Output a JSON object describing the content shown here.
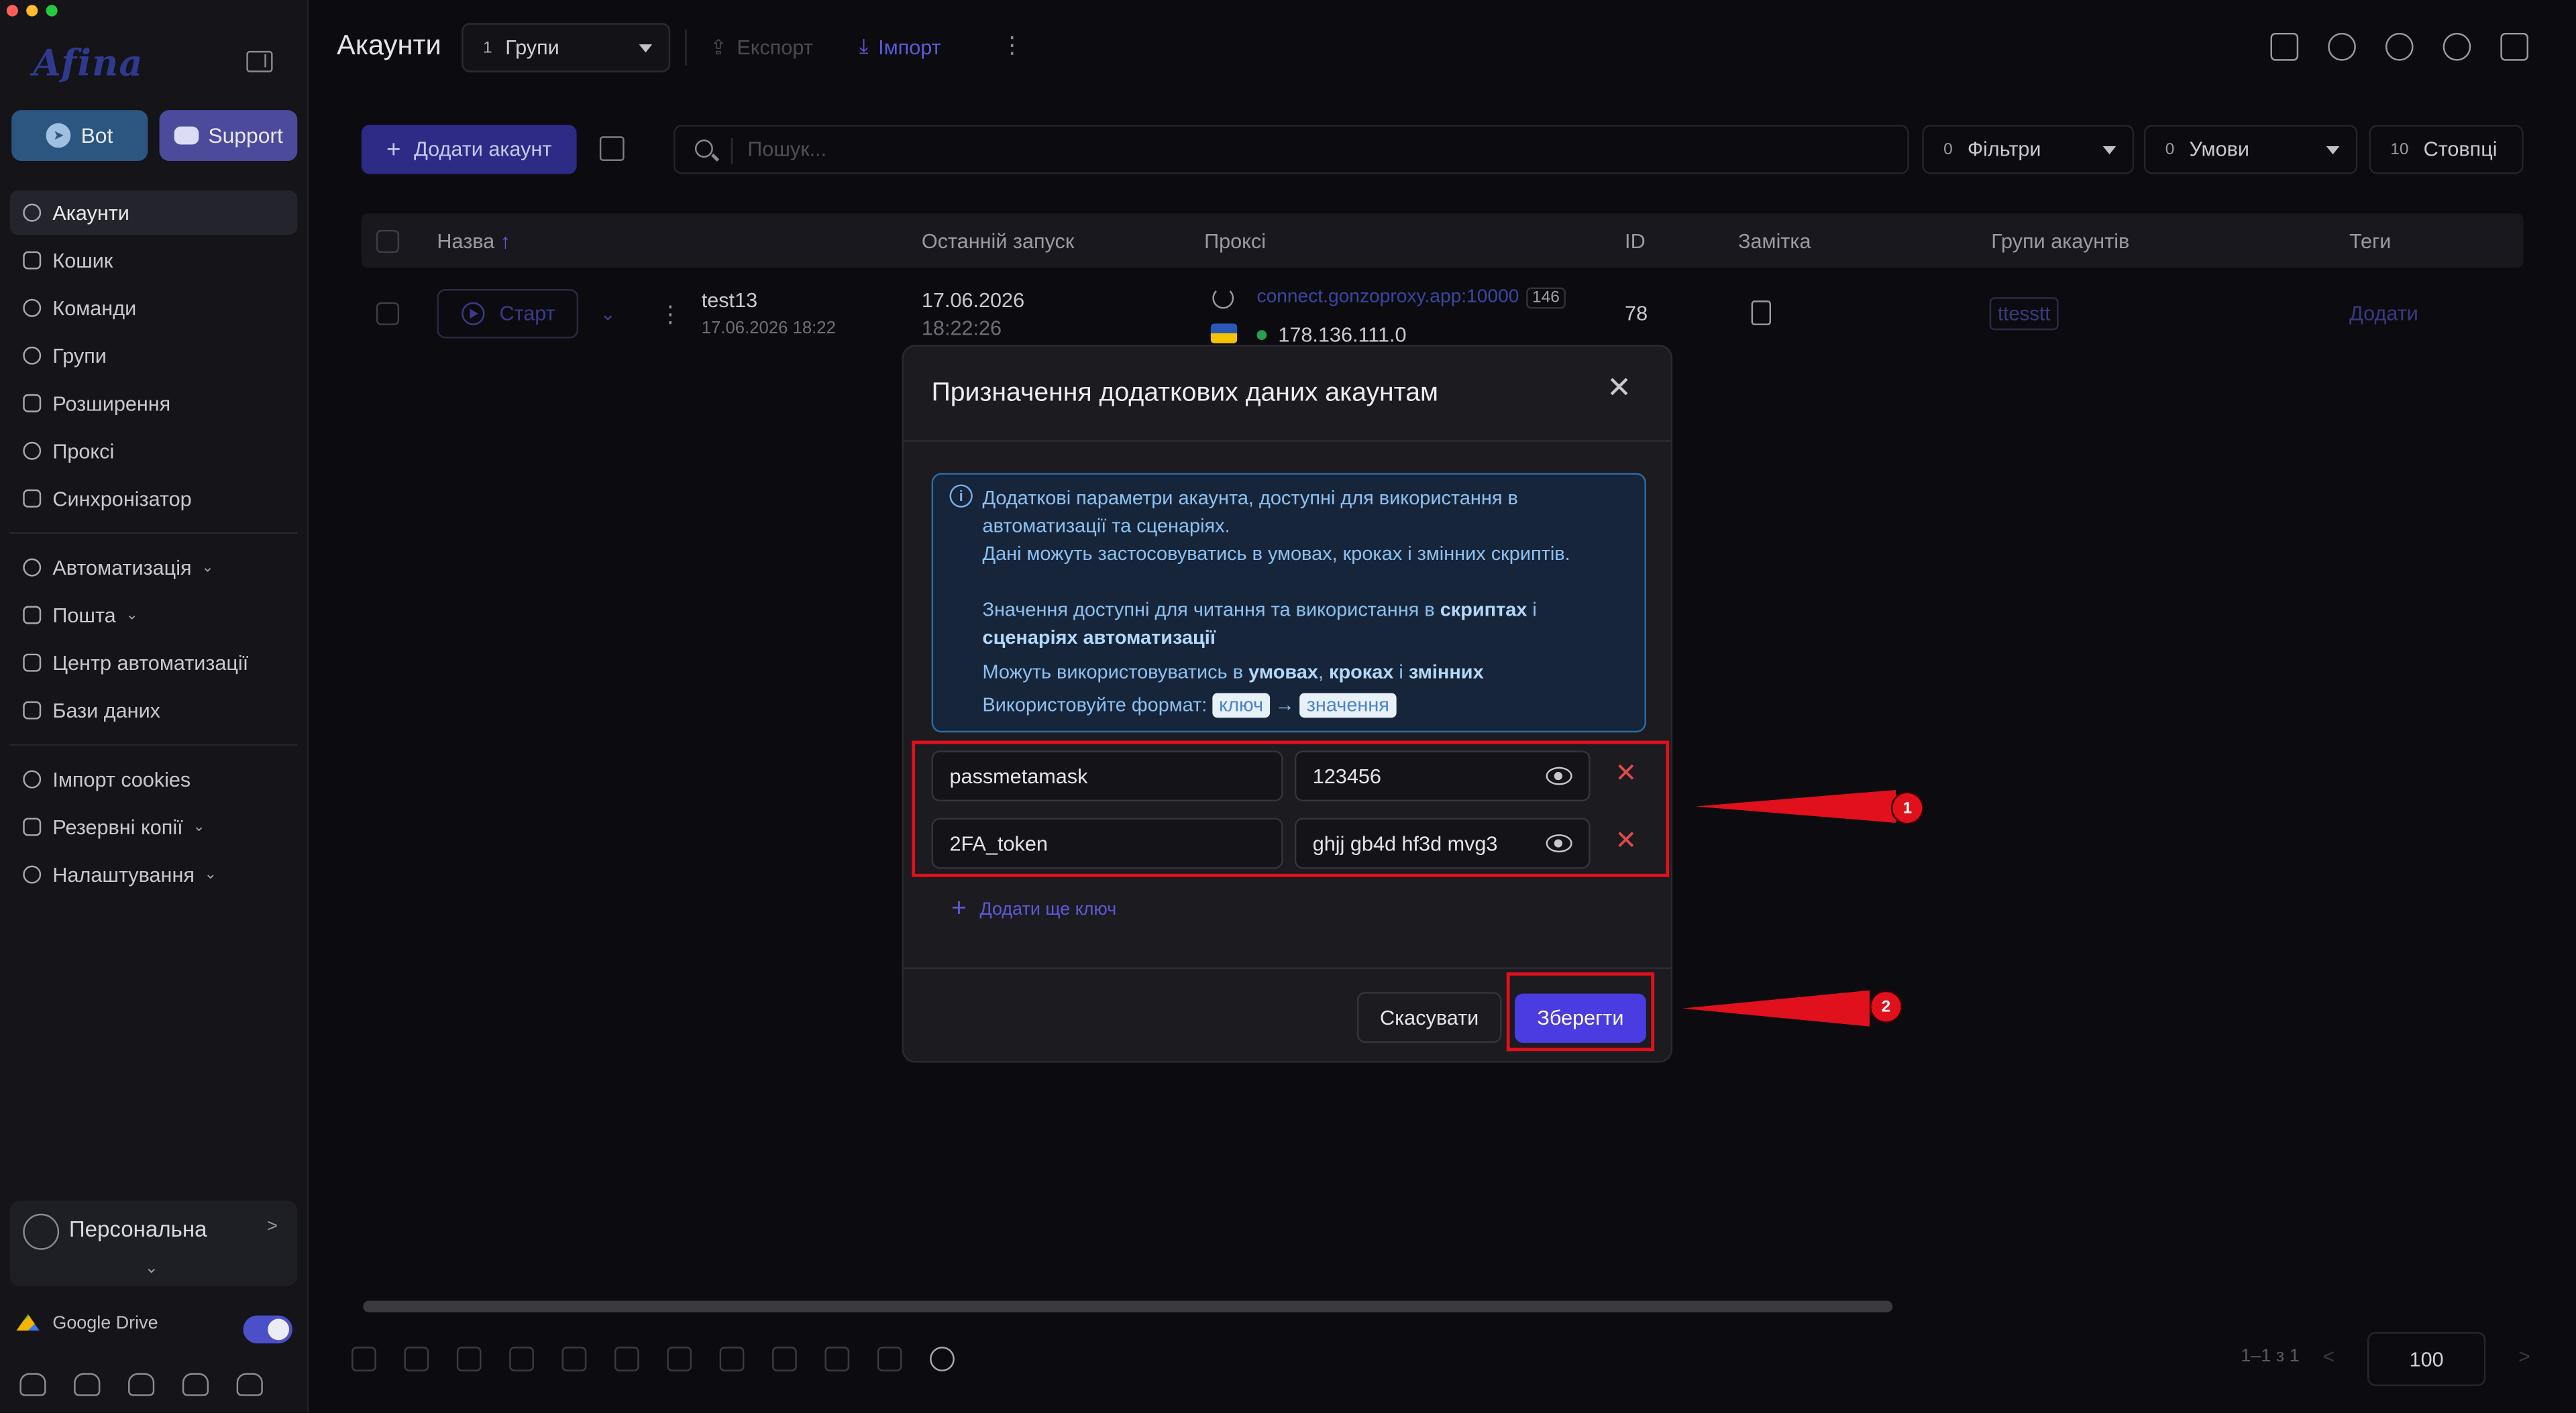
{
  "app": {
    "logo": "Afina"
  },
  "sidebar": {
    "bot_label": "Bot",
    "support_label": "Support",
    "items": [
      {
        "label": "Акаунти"
      },
      {
        "label": "Кошик"
      },
      {
        "label": "Команди"
      },
      {
        "label": "Групи"
      },
      {
        "label": "Розширення"
      },
      {
        "label": "Проксі"
      },
      {
        "label": "Синхронізатор"
      },
      {
        "label": "Автоматизація"
      },
      {
        "label": "Пошта"
      },
      {
        "label": "Центр автоматизації"
      },
      {
        "label": "Бази даних"
      },
      {
        "label": "Імпорт cookies"
      },
      {
        "label": "Резервні копії"
      },
      {
        "label": "Налаштування"
      }
    ],
    "profile_label": "Персональна",
    "gdrive_label": "Google Drive",
    "gdrive_enabled": true
  },
  "header": {
    "title": "Акаунти",
    "group_count": "1",
    "group_label": "Групи",
    "export_label": "Експорт",
    "import_label": "Імпорт"
  },
  "toolbar": {
    "add_account_label": "Додати акаунт",
    "search_placeholder": "Пошук...",
    "filters_count": "0",
    "filters_label": "Фільтри",
    "conditions_count": "0",
    "conditions_label": "Умови",
    "columns_count": "10",
    "columns_label": "Стовпці"
  },
  "table": {
    "columns": [
      "Назва",
      "Останній запуск",
      "Проксі",
      "ID",
      "Замітка",
      "Групи акаунтів",
      "Теги"
    ],
    "row": {
      "start_label": "Старт",
      "name": "test13",
      "created": "17.06.2026 18:22",
      "last_run_date": "17.06.2026",
      "last_run_time": "18:22:26",
      "proxy_host": "connect.gonzoproxy.app:10000",
      "proxy_badge": "146",
      "proxy_ip": "178.136.111.0",
      "id": "78",
      "group_tag": "ttesstt",
      "tags_link": "Додати"
    }
  },
  "pagination": {
    "range": "1–1 з 1",
    "per_page": "100"
  },
  "modal": {
    "title": "Призначення додаткових даних акаунтам",
    "info": {
      "line1": "Додаткові параметри акаунта, доступні для використання в",
      "line2": "автоматизації та сценаріях.",
      "line3": "Дані можуть застосовуватись в умовах, кроках і змінних скриптів.",
      "line4_a": "Значення доступні для читання та використання в ",
      "line4_b": "скриптах",
      "line4_c": " і",
      "line5": "сценаріях автоматизації",
      "line6_a": "Можуть використовуватись в ",
      "line6_b": "умовах",
      "line6_c": ", ",
      "line6_d": "кроках",
      "line6_e": " і ",
      "line6_f": "змінних",
      "line7_a": "Використовуйте формат: ",
      "line7_key": "ключ",
      "line7_arrow": "→",
      "line7_value": "значення"
    },
    "pairs": [
      {
        "key": "passmetamask",
        "value": "123456"
      },
      {
        "key": "2FA_token",
        "value": "ghjj gb4d hf3d mvg3"
      }
    ],
    "add_key_label": "Додати ще ключ",
    "cancel_label": "Скасувати",
    "save_label": "Зберегти"
  },
  "annotations": {
    "marker_1": "1",
    "marker_2": "2",
    "color": "#e0101c"
  },
  "colors": {
    "accent": "#4a3ce0",
    "info_border": "#2f6aa6",
    "danger": "#e04a4a"
  }
}
